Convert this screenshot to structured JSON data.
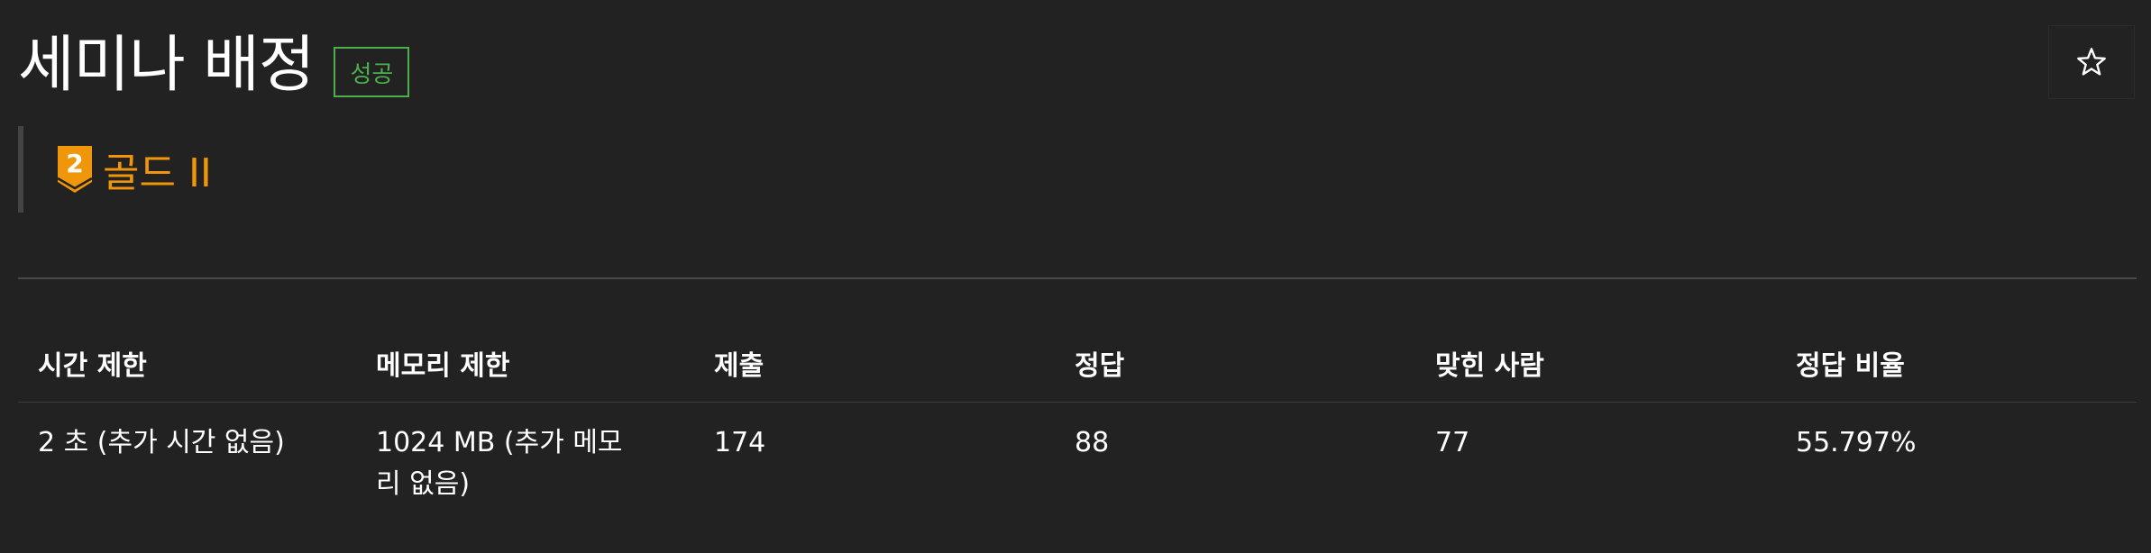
{
  "problem": {
    "title": "세미나 배정",
    "status_badge": "성공",
    "tier": {
      "level": "2",
      "label": "골드 II",
      "color": "#f0960a"
    },
    "favorite_icon": "star-outline-icon"
  },
  "info_table": {
    "headers": [
      "시간 제한",
      "메모리 제한",
      "제출",
      "정답",
      "맞힌 사람",
      "정답 비율"
    ],
    "row": [
      "2 초 (추가 시간 없음)",
      "1024 MB (추가 메모리 없음)",
      "174",
      "88",
      "77",
      "55.797%"
    ]
  },
  "colors": {
    "background": "#222222",
    "success": "#4cb04c",
    "gold": "#f0960a"
  }
}
